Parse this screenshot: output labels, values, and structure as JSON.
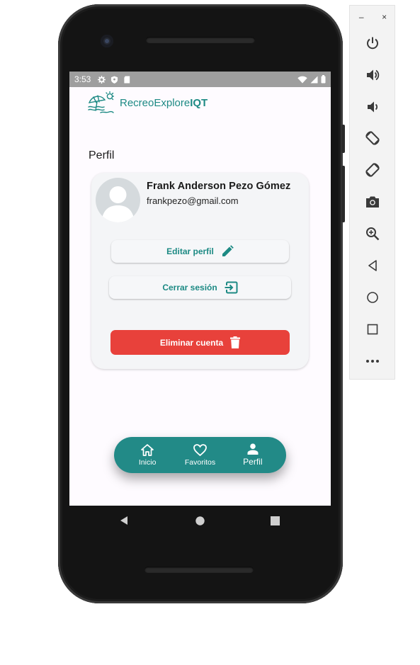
{
  "status_bar": {
    "time": "3:53"
  },
  "app": {
    "brand_prefix": "RecreoExplore",
    "brand_suffix": "IQT"
  },
  "page": {
    "title": "Perfil"
  },
  "profile": {
    "name": "Frank Anderson Pezo Gómez",
    "email": "frankpezo@gmail.com"
  },
  "actions": {
    "edit_label": "Editar perfil",
    "logout_label": "Cerrar sesión",
    "delete_label": "Eliminar cuenta"
  },
  "bottom_nav": {
    "items": [
      {
        "label": "Inicio",
        "icon": "home-icon"
      },
      {
        "label": "Favoritos",
        "icon": "heart-icon"
      },
      {
        "label": "Perfil",
        "icon": "person-icon",
        "active": true
      }
    ]
  },
  "emulator_panel": {
    "window_controls": [
      "–",
      "×"
    ],
    "buttons": [
      "power-icon",
      "volume-up-icon",
      "volume-down-icon",
      "rotate-left-icon",
      "rotate-right-icon",
      "camera-icon",
      "zoom-icon",
      "back-icon",
      "home-icon",
      "overview-icon",
      "more-icon"
    ]
  },
  "colors": {
    "accent": "#228a87",
    "danger": "#e8413b",
    "screen_bg": "#fefbff",
    "card_bg": "#f4f5f7"
  }
}
